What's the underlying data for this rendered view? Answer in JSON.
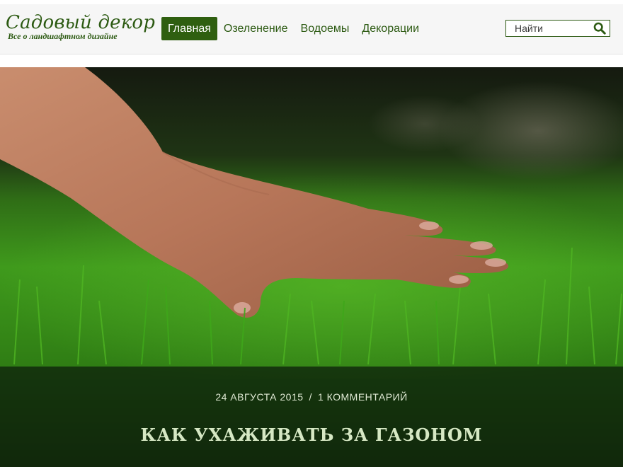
{
  "logo": {
    "title": "Садовый декор",
    "subtitle": "Все о ландшафтном дизайне"
  },
  "nav": {
    "items": [
      {
        "label": "Главная",
        "active": true
      },
      {
        "label": "Озеленение",
        "active": false
      },
      {
        "label": "Водоемы",
        "active": false
      },
      {
        "label": "Декорации",
        "active": false
      }
    ]
  },
  "search": {
    "placeholder": "Найти",
    "icon": "search-icon"
  },
  "hero": {
    "image": "hand touching green lawn",
    "meta": {
      "date": "24 АВГУСТА 2015",
      "separator": "/",
      "comments": "1 КОММЕНТАРИЙ"
    },
    "title": "КАК УХАЖИВАТЬ ЗА ГАЗОНОМ"
  },
  "colors": {
    "brand_green": "#2c5a12",
    "nav_active_bg": "#2f5f10",
    "header_bg": "#f6f6f6",
    "caption_text": "#d6e8c4"
  }
}
